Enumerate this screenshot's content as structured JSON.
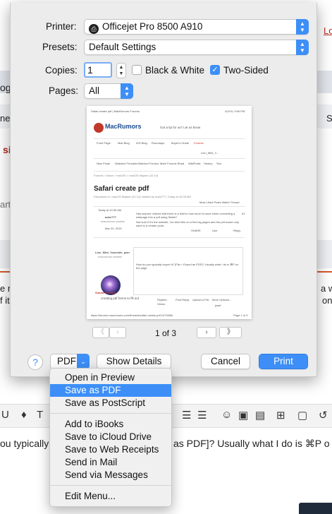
{
  "background_page": {
    "fragments": {
      "login_link": "Lo",
      "og": "og",
      "ned": "ned",
      "s_right": "S",
      "si": "si",
      "arte": "arte",
      "left_e": "e n",
      "right_a": "a w",
      "if_it": "f it'",
      "right_on": "on",
      "editor_text": "you typically",
      "editor_text_right": "as PDF]? Usually what I do is ⌘P o",
      "editor_text_prefix": "ou typically"
    }
  },
  "print_dialog": {
    "printer_label": "Printer:",
    "printer_value": "Officejet Pro 8500 A910",
    "presets_label": "Presets:",
    "presets_value": "Default Settings",
    "copies_label": "Copies:",
    "copies_value": "1",
    "black_white_label": "Black & White",
    "black_white_checked": false,
    "two_sided_label": "Two-Sided",
    "two_sided_checked": true,
    "pages_label": "Pages:",
    "pages_value": "All",
    "page_indicator": "1 of 3",
    "help_label": "?",
    "pdf_label": "PDF",
    "show_details_label": "Show Details",
    "cancel_label": "Cancel",
    "print_label": "Print",
    "accent_color": "#3d8ff7"
  },
  "preview": {
    "header_left": "Safari create pdf | MacRumors Forums",
    "header_right": "4/2/15, 9:06 PM",
    "logo_text": "MacRumors",
    "tagline": "Got a tip for us? Let us know",
    "nav": [
      "Front Page",
      "Mac Blog",
      "iOS Blog",
      "Roundups",
      "Buyer's Guide",
      "Forums"
    ],
    "user": "Lion_Mint_Y...",
    "subnav": [
      "New Posts",
      "Watched Threads",
      "Watched Forums",
      "Mark Forums Read",
      "WikiPosts",
      "History",
      "Sho"
    ],
    "breadcrumb": "Forums > Macs > macOS > macOS Mojave (10.14)",
    "thread_title": "Safari create pdf",
    "thread_meta": "Discussion in 'macOS Mojave (10.14)' started by aoke777, Today at 10:35 AM",
    "most_liked": "Most Liked Posts   Watch Thread",
    "post_time": "Today at 10:35 AM",
    "post_num": "#1",
    "poster": "aoke777",
    "poster_role": "macrumors newbie",
    "joined": "Mar 20, 2015",
    "post_body_1": "Has anyone noticed that there is a limit to how much to save when converting a webpage into a pdf using Safari?",
    "post_body_2": "Not sure if it's the website, I've tried this on a few big pages and the pdf would only save to a certain point.",
    "actions": [
      "SHARE",
      "Like",
      "Reply"
    ],
    "reply_user": "Lion_Mint_Yosemite_pwn",
    "reply_role": "macrumors newbie",
    "reply_text": "How do you typically export it? [File > Export as PDF]? Usually what I do is ⌘P on the page",
    "reply_buttons": [
      "Post Reply",
      "Upload a File",
      "More Options..."
    ],
    "similar_header": "Similar Threads",
    "similar_title": "creating pdf forms to fill out",
    "similar_replies_label": "Replies:",
    "similar_replies": "6",
    "similar_views_label": "Views:",
    "similar_views": "983",
    "similar_user": "josef",
    "footer_url": "https://forums.macrumors.com/threads/safari-create-pdf.1979498/",
    "footer_page": "Page 1 of 3"
  },
  "pdf_menu": {
    "items_group1": [
      "Open in Preview",
      "Save as PDF",
      "Save as PostScript"
    ],
    "items_group2": [
      "Add to iBooks",
      "Save to iCloud Drive",
      "Save to Web Receipts",
      "Send in Mail",
      "Send via Messages"
    ],
    "items_group3": [
      "Edit Menu..."
    ],
    "selected": "Save as PDF"
  }
}
